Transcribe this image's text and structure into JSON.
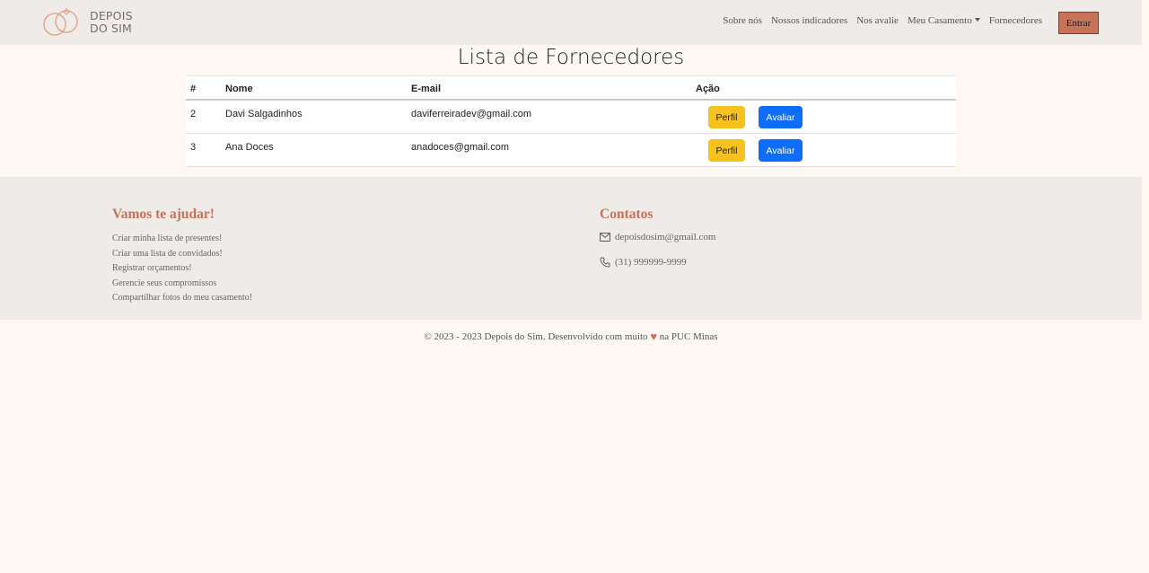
{
  "brand": {
    "line1": "DEPOIS",
    "line2": "DO SIM"
  },
  "nav": {
    "items": [
      "Sobre nós",
      "Nossos indicadores",
      "Nos avalie",
      "Meu Casamento",
      "Fornecedores"
    ],
    "login_label": "Entrar"
  },
  "page": {
    "title": "Lista de Fornecedores"
  },
  "table": {
    "headers": {
      "id": "#",
      "name": "Nome",
      "email": "E-mail",
      "action": "Ação"
    },
    "rows": [
      {
        "id": "2",
        "name": "Davi Salgadinhos",
        "email": "daviferreiradev@gmail.com",
        "profile_label": "Perfil",
        "rate_label": "Avaliar"
      },
      {
        "id": "3",
        "name": "Ana Doces",
        "email": "anadoces@gmail.com",
        "profile_label": "Perfil",
        "rate_label": "Avaliar"
      }
    ]
  },
  "footer": {
    "help_heading": "Vamos te ajudar!",
    "help_items": [
      "Criar minha lista de presentes!",
      "Criar uma lista de convidados!",
      "Registrar orçamentos!",
      "Gerencie seus compromissos",
      "Compartilhar fotos do meu casamento!"
    ],
    "contact_heading": "Contatos",
    "contact_email": "depoisdosim@gmail.com",
    "contact_phone": "(31) 999999-9999",
    "copyright_before": "© 2023 - 2023 Depois do Sim. Desenvolvido com muito",
    "copyright_after": "na PUC Minas"
  },
  "colors": {
    "accent": "#c9725a",
    "nav_bg": "#efebe8",
    "page_bg": "#fdf9f2",
    "warning": "#f6c21b",
    "primary": "#0d6efd"
  },
  "icons": {
    "logo": "rings-icon",
    "email": "envelope-icon",
    "phone": "phone-icon",
    "heart": "heart-icon",
    "dropdown": "caret-down-icon"
  }
}
